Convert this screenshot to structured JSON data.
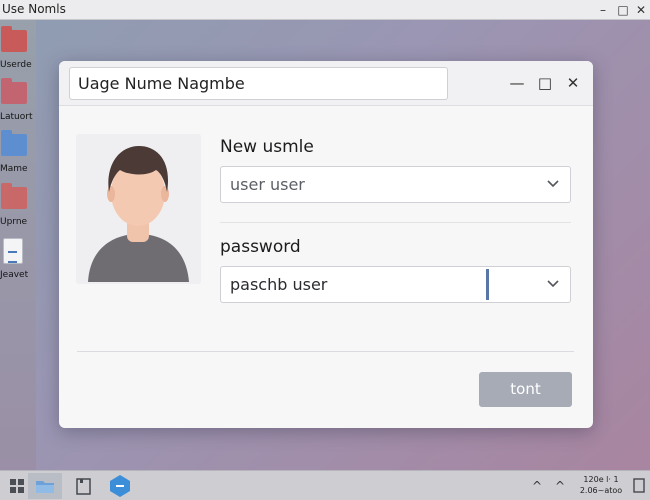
{
  "window": {
    "title": "Use Nomls",
    "minimize": "–",
    "maximize": "□",
    "close": "✕"
  },
  "desktop": {
    "icons": [
      {
        "label": "Userde",
        "icon": "folder-red-icon",
        "color": "#c85a5a"
      },
      {
        "label": "Latuort",
        "icon": "folder-red-icon",
        "color": "#c26570"
      },
      {
        "label": "Mame",
        "icon": "folder-blue-icon",
        "color": "#5d8fd0"
      },
      {
        "label": "Uprne",
        "icon": "folder-red-icon",
        "color": "#c96868"
      },
      {
        "label": "Jeavet",
        "icon": "document-icon",
        "color": "#4a78b8"
      }
    ]
  },
  "dialog": {
    "title": "Uage Nume Nagmbe",
    "minimize": "—",
    "maximize": "□",
    "close": "✕",
    "username_label": "New usmle",
    "username_value": "user user",
    "password_label": "password",
    "password_value": "paschb user",
    "dropdown_arrow": "⌄",
    "primary_button": "tont"
  },
  "taskbar": {
    "tray_up": "^",
    "tray_up2": "^",
    "clock_line1": "120e l· 1",
    "clock_line2": "2.06~atoo"
  },
  "colors": {
    "accent": "#5877a6",
    "button_disabled": "#a6abb6",
    "taskbar": "#cdcdd2"
  }
}
